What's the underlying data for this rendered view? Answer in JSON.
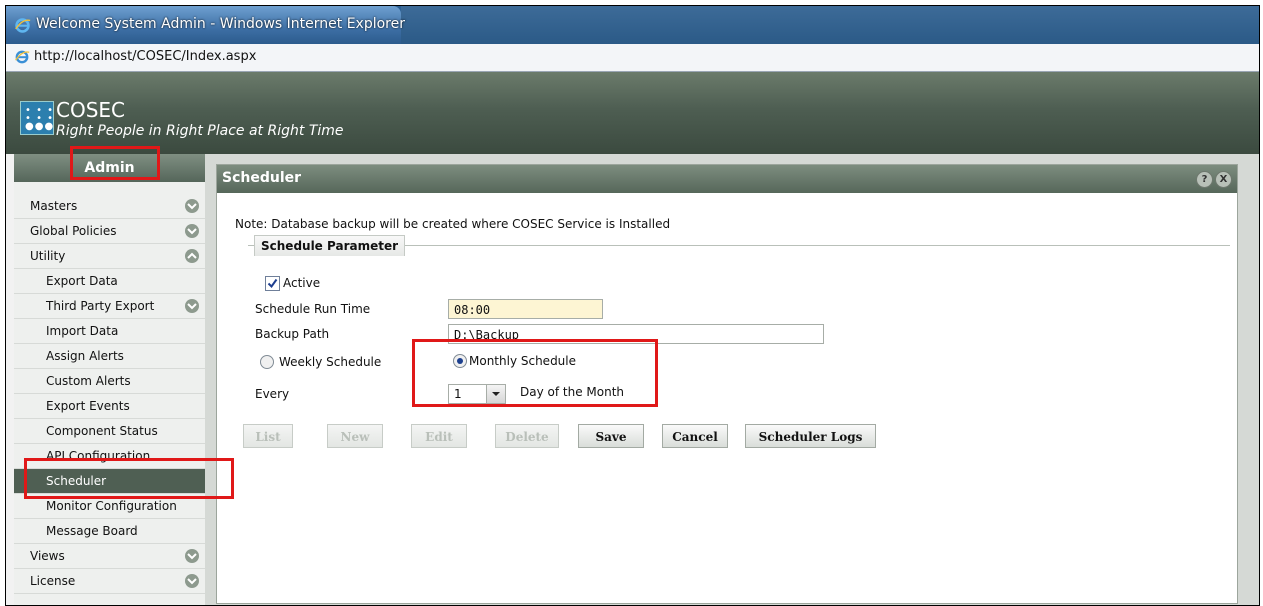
{
  "window": {
    "title": "Welcome System Admin - Windows Internet Explorer"
  },
  "address": {
    "url": "http://localhost/COSEC/Index.aspx"
  },
  "app": {
    "name": "COSEC",
    "tagline": "Right People in Right Place at Right Time"
  },
  "sidebar": {
    "header": "Admin",
    "items": [
      {
        "label": "Masters"
      },
      {
        "label": "Global Policies"
      },
      {
        "label": "Utility"
      },
      {
        "label": "Export Data"
      },
      {
        "label": "Third Party Export"
      },
      {
        "label": "Import Data"
      },
      {
        "label": "Assign Alerts"
      },
      {
        "label": "Custom Alerts"
      },
      {
        "label": "Export Events"
      },
      {
        "label": "Component Status"
      },
      {
        "label": "API Configuration"
      },
      {
        "label": "Scheduler"
      },
      {
        "label": "Monitor Configuration"
      },
      {
        "label": "Message Board"
      },
      {
        "label": "Views"
      },
      {
        "label": "License"
      }
    ]
  },
  "panel": {
    "title": "Scheduler",
    "help_glyph": "?",
    "close_glyph": "X",
    "note": "Note: Database backup will be created where COSEC Service is Installed",
    "legend": "Schedule Parameter",
    "active_label": "Active",
    "active_checked": true,
    "run_time_label": "Schedule Run Time",
    "run_time_value": "08:00",
    "backup_path_label": "Backup Path",
    "backup_path_value": "D:\\Backup",
    "weekly_label": "Weekly Schedule",
    "monthly_label": "Monthly Schedule",
    "selected_schedule": "Monthly Schedule",
    "every_label": "Every",
    "day_value": "1",
    "day_suffix": "Day of the Month"
  },
  "buttons": {
    "list": "List",
    "new": "New",
    "edit": "Edit",
    "delete": "Delete",
    "save": "Save",
    "cancel": "Cancel",
    "scheduler_logs": "Scheduler Logs"
  },
  "colors": {
    "highlight_box": "#e01818",
    "active_nav": "#4f5f53"
  }
}
